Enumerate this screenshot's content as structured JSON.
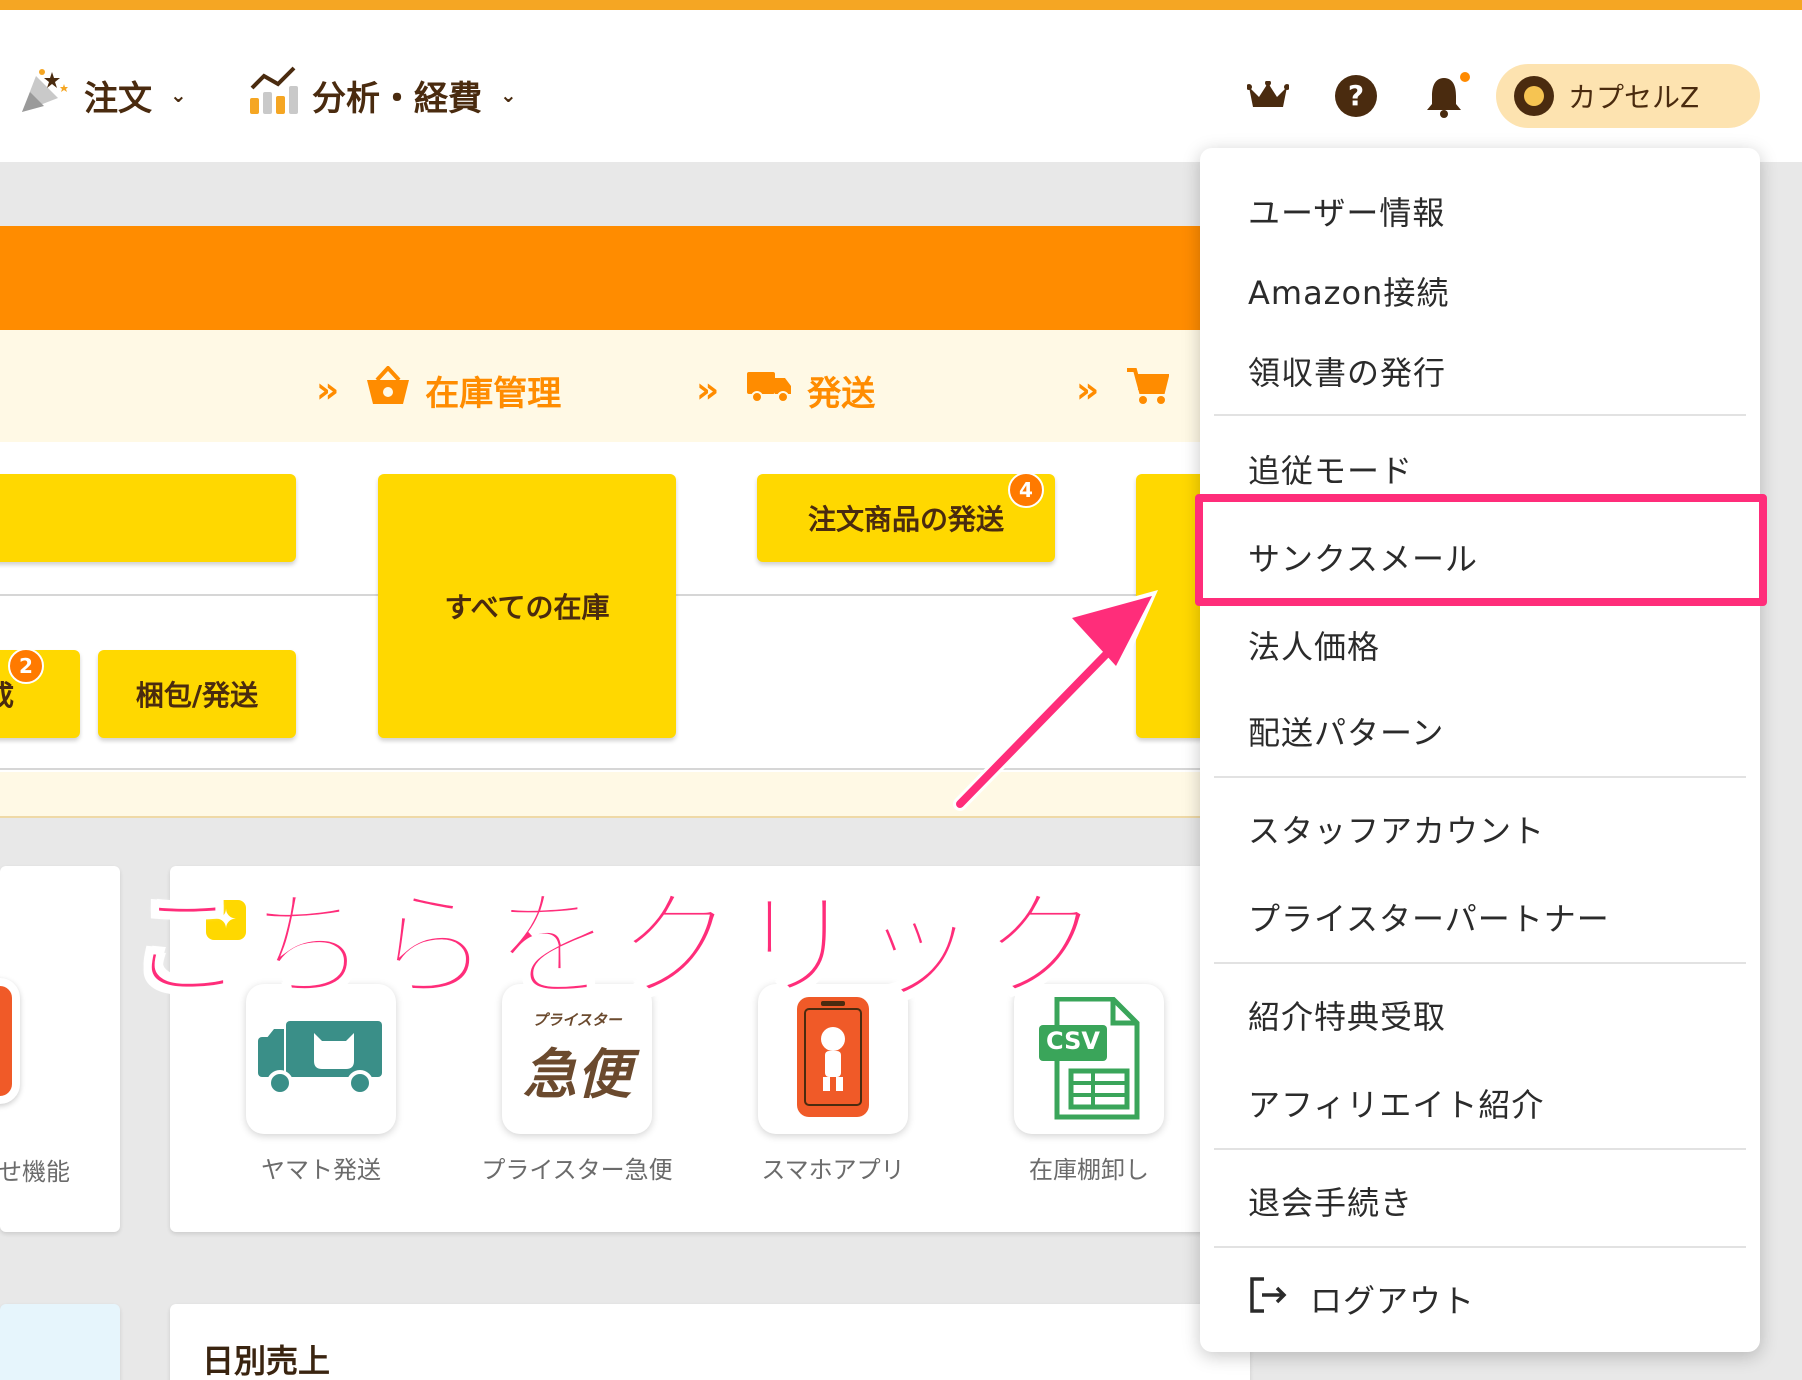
{
  "header": {
    "nav": [
      {
        "label": "注文"
      },
      {
        "label": "分析・経費"
      }
    ],
    "user_name": "カプセルZ"
  },
  "workflow": {
    "steps": [
      {
        "label": "在庫管理"
      },
      {
        "label": "発送"
      }
    ],
    "buttons": {
      "all_inventory": "すべての在庫",
      "ship_ordered": "注文商品の発送",
      "ship_ordered_badge": "4",
      "pack_ship": "梱包/発送",
      "left_partial": "成",
      "left_partial_badge": "2"
    }
  },
  "tools": {
    "left_partial_label": "せ機能",
    "items": [
      {
        "label": "ヤマト発送",
        "icon": "yamato-truck-icon"
      },
      {
        "label": "プライスター急便",
        "icon": "pricester-kyubin-icon",
        "logo_text_top": "プライスター",
        "logo_text_main": "急便"
      },
      {
        "label": "スマホアプリ",
        "icon": "smartphone-app-icon"
      },
      {
        "label": "在庫棚卸し",
        "icon": "csv-file-icon",
        "logo_text": "CSV"
      }
    ]
  },
  "daily_sales": {
    "title": "日別売上"
  },
  "dropdown": {
    "groups": [
      [
        "ユーザー情報",
        "Amazon接続",
        "領収書の発行"
      ],
      [
        "追従モード",
        "サンクスメール",
        "法人価格",
        "配送パターン"
      ],
      [
        "スタッフアカウント",
        "プライスターパートナー"
      ],
      [
        "紹介特典受取",
        "アフィリエイト紹介"
      ],
      [
        "退会手続き"
      ]
    ],
    "logout": "ログアウト"
  },
  "annotation": {
    "callout": "こちらをクリック",
    "highlight_color": "#ff2d7a"
  },
  "colors": {
    "accent_orange": "#ff8c00",
    "button_yellow": "#ffd800",
    "text_brown": "#4a2b0f"
  }
}
